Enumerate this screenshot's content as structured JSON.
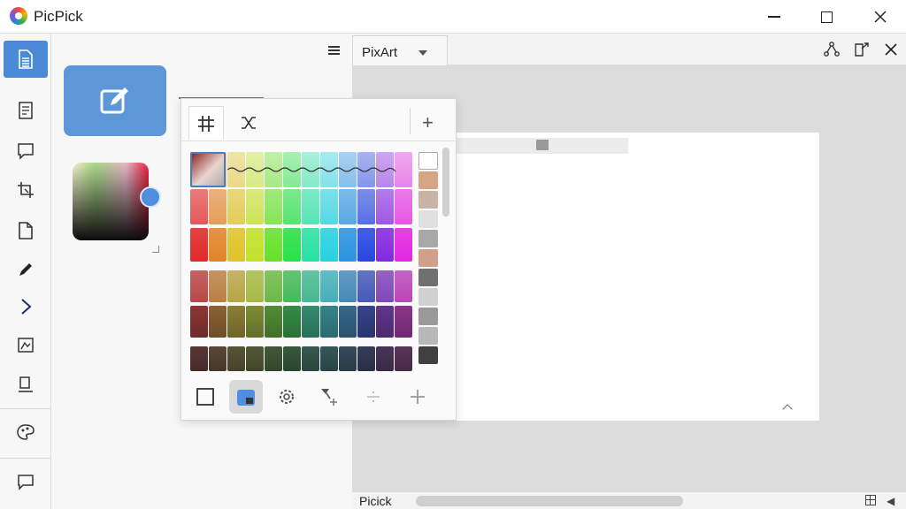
{
  "app": {
    "title": "PicPick"
  },
  "window_controls": {
    "minimize": "minimize",
    "maximize": "maximize",
    "close": "close"
  },
  "sidebar": {
    "items": [
      {
        "icon": "document-lines-icon",
        "active": true
      },
      {
        "icon": "page-icon"
      },
      {
        "icon": "speech-bubble-icon"
      },
      {
        "icon": "crop-icon"
      },
      {
        "icon": "file-icon"
      },
      {
        "icon": "pen-icon"
      },
      {
        "icon": "pointer-icon"
      },
      {
        "icon": "image-edit-icon"
      },
      {
        "icon": "stamp-icon"
      },
      {
        "icon": "palette-icon"
      },
      {
        "icon": "comment-icon"
      }
    ]
  },
  "tab": {
    "label": "PixArt"
  },
  "toolbar_icons": [
    "share-icon",
    "export-icon",
    "close-icon"
  ],
  "popup": {
    "tabs": [
      "grid-icon",
      "shuffle-icon"
    ],
    "add": "+",
    "bottom_tools": [
      "square-icon",
      "fill-icon",
      "gear-icon",
      "brush-plus-icon",
      "divide-icon",
      "plus-icon"
    ]
  },
  "status": {
    "text": "Picick"
  },
  "colors": {
    "accent": "#5e97d8",
    "sidebar_active": "#4a8ad6"
  }
}
